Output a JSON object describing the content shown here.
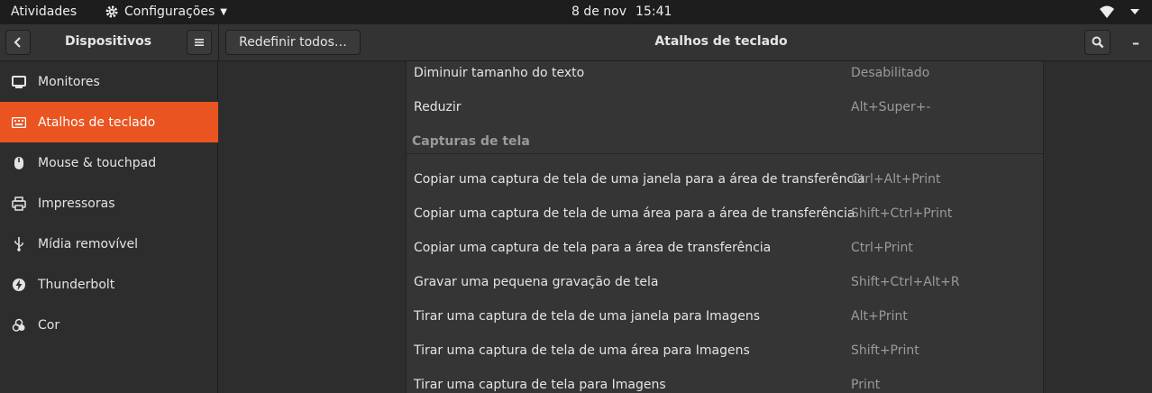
{
  "topbar": {
    "activities": "Atividades",
    "app_menu": "Configurações",
    "date": "8 de nov",
    "time": "15:41"
  },
  "header": {
    "left_title": "Dispositivos",
    "reset_label": "Redefinir todos…",
    "title": "Atalhos de teclado",
    "minimize_glyph": "–"
  },
  "sidebar": {
    "items": [
      {
        "label": "Monitores",
        "icon": "monitor-icon",
        "active": false
      },
      {
        "label": "Atalhos de teclado",
        "icon": "keyboard-icon",
        "active": true
      },
      {
        "label": "Mouse & touchpad",
        "icon": "mouse-icon",
        "active": false
      },
      {
        "label": "Impressoras",
        "icon": "printer-icon",
        "active": false
      },
      {
        "label": "Mídia removível",
        "icon": "usb-icon",
        "active": false
      },
      {
        "label": "Thunderbolt",
        "icon": "thunderbolt-icon",
        "active": false
      },
      {
        "label": "Cor",
        "icon": "color-icon",
        "active": false
      }
    ]
  },
  "shortcuts": {
    "top_rows": [
      {
        "desc": "Diminuir tamanho do texto",
        "accel": "Desabilitado"
      },
      {
        "desc": "Reduzir",
        "accel": "Alt+Super+-"
      }
    ],
    "section_title": "Capturas de tela",
    "rows": [
      {
        "desc": "Copiar uma captura de tela de uma janela para a área de transferência",
        "accel": "Ctrl+Alt+Print"
      },
      {
        "desc": "Copiar uma captura de tela de uma área para a área de transferência",
        "accel": "Shift+Ctrl+Print"
      },
      {
        "desc": "Copiar uma captura de tela para a área de transferência",
        "accel": "Ctrl+Print"
      },
      {
        "desc": "Gravar uma pequena gravação de tela",
        "accel": "Shift+Ctrl+Alt+R"
      },
      {
        "desc": "Tirar uma captura de tela de uma janela para Imagens",
        "accel": "Alt+Print"
      },
      {
        "desc": "Tirar uma captura de tela de uma área para Imagens",
        "accel": "Shift+Print"
      },
      {
        "desc": "Tirar uma captura de tela para Imagens",
        "accel": "Print"
      }
    ]
  },
  "colors": {
    "accent": "#e95420",
    "topbar": "#1d1d1d",
    "panel": "#353535"
  }
}
